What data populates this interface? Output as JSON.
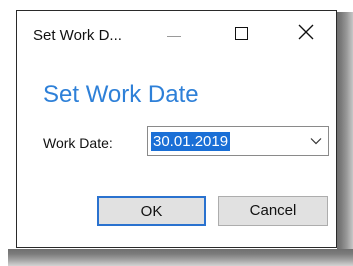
{
  "window": {
    "title": "Set Work D...",
    "controls": {
      "minimize_icon": "minimize-icon",
      "maximize_icon": "maximize-icon",
      "close_icon": "close-icon"
    }
  },
  "dialog": {
    "heading": "Set Work Date",
    "field": {
      "label": "Work Date:",
      "value": "30.01.2019",
      "dropdown_icon": "chevron-down-icon"
    },
    "buttons": {
      "ok": "OK",
      "cancel": "Cancel"
    }
  },
  "colors": {
    "heading": "#2e80d8",
    "selection": "#1a6fd6",
    "default_button_border": "#2a72cf",
    "button_face": "#e1e1e1"
  }
}
